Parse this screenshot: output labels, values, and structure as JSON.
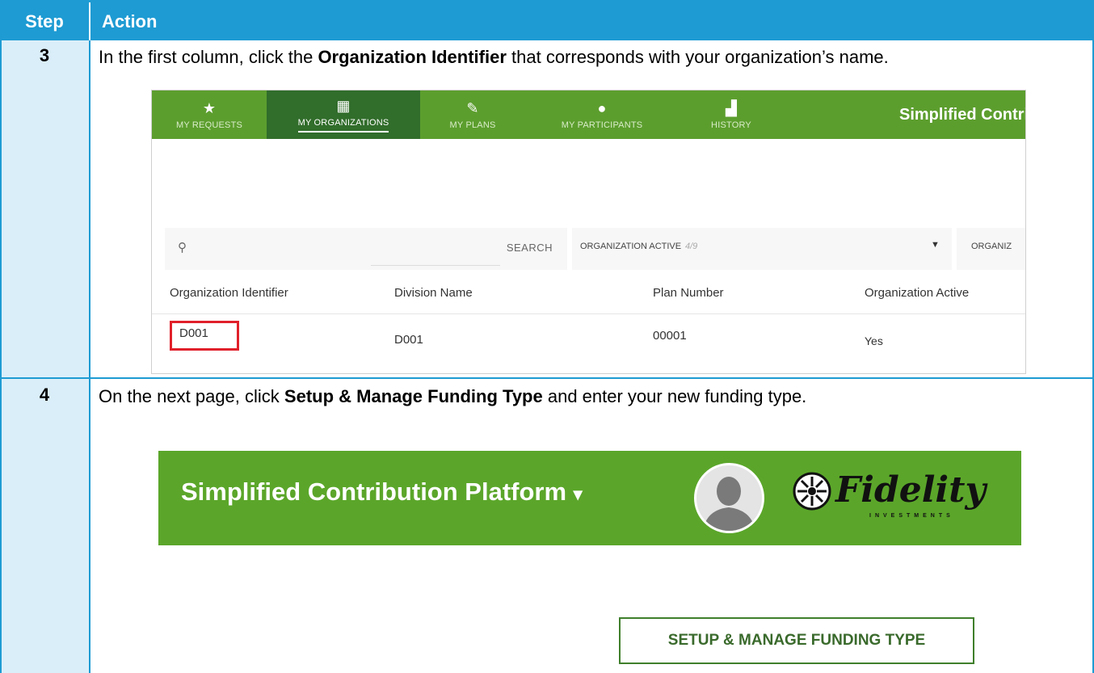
{
  "table": {
    "header_step": "Step",
    "header_action": "Action",
    "colors": {
      "header_bg": "#1E9BD3",
      "step_col_bg": "#DAEEF9"
    }
  },
  "steps": [
    {
      "number": "3",
      "text_before": "In the first column, click the ",
      "bold": "Organization Identifier",
      "text_after": " that corresponds with your organization’s name."
    },
    {
      "number": "4",
      "text_before": "On the next page, click ",
      "bold": "Setup & Manage Funding Type",
      "text_after": " and enter your new funding type."
    }
  ],
  "screenshot1": {
    "nav": [
      {
        "icon": "star-icon",
        "label": "MY REQUESTS",
        "active": false
      },
      {
        "icon": "building-icon",
        "label": "MY ORGANIZATIONS",
        "active": true
      },
      {
        "icon": "pencil-icon",
        "label": "MY PLANS",
        "active": false
      },
      {
        "icon": "person-icon",
        "label": "MY PARTICIPANTS",
        "active": false
      },
      {
        "icon": "chart-icon",
        "label": "HISTORY",
        "active": false
      }
    ],
    "app_title": "Simplified Contrib",
    "search_button": "SEARCH",
    "filter_label": "ORGANIZATION ACTIVE",
    "filter_value": "4/9",
    "filter2_label": "ORGANIZ",
    "columns": [
      "Organization Identifier",
      "Division Name",
      "Plan Number",
      "Organization Active"
    ],
    "row": [
      "D001",
      "D001",
      "00001",
      "Yes"
    ],
    "accent": "#5C9E2E",
    "highlight": "#E0202A"
  },
  "screenshot2": {
    "app_title": "Simplified Contribution Platform",
    "dropdown_caret": "▾",
    "logo_text": "Fidelity",
    "logo_sub": "INVESTMENTS",
    "setup_button": "SETUP & MANAGE FUNDING TYPE",
    "accent": "#5BA62A"
  }
}
